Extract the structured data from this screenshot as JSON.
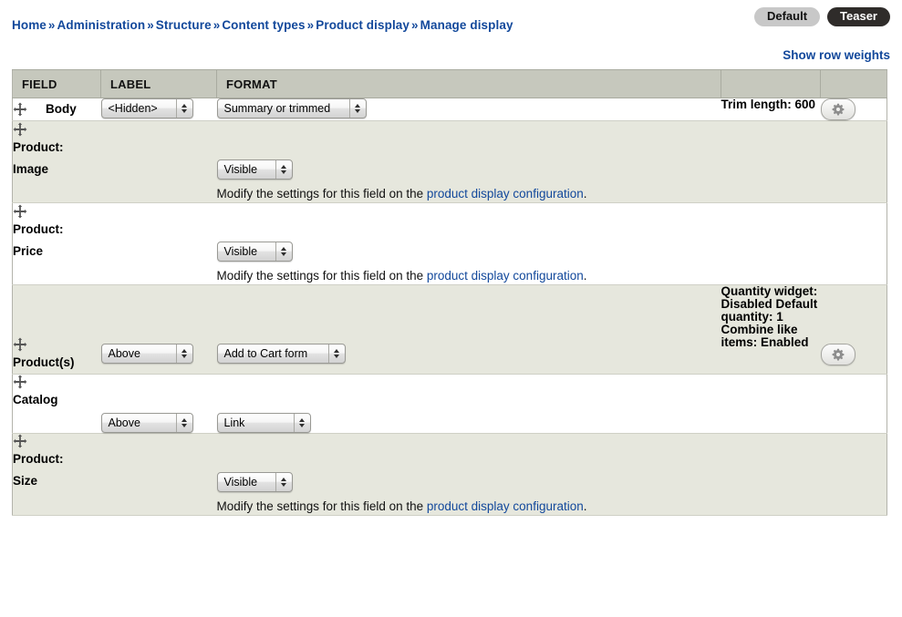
{
  "breadcrumb": {
    "separator": "»",
    "items": [
      {
        "label": "Home"
      },
      {
        "label": "Administration"
      },
      {
        "label": "Structure"
      },
      {
        "label": "Content types"
      },
      {
        "label": "Product display"
      },
      {
        "label": "Manage display"
      }
    ]
  },
  "view_tabs": [
    {
      "label": "Default",
      "state": "inactive"
    },
    {
      "label": "Teaser",
      "state": "active"
    }
  ],
  "row_weights": {
    "link_label": "Show row weights"
  },
  "table": {
    "columns": [
      "FIELD",
      "LABEL",
      "FORMAT",
      "",
      ""
    ],
    "rows": [
      {
        "field": "Body",
        "layout": "inline",
        "stripe": "odd",
        "label_select": "<Hidden>",
        "format_select": "Summary or trimmed",
        "description": null,
        "description_link": null,
        "summary": "Trim length: 600",
        "has_settings_button": true
      },
      {
        "field": "Product:\nImage",
        "layout": "stacked",
        "stripe": "even",
        "label_select": null,
        "format_select": "Visible",
        "description": "Modify the settings for this field on the ",
        "description_link": "product display configuration",
        "description_end": ".",
        "summary": null,
        "has_settings_button": false
      },
      {
        "field": "Product:\nPrice",
        "layout": "stacked",
        "stripe": "odd",
        "label_select": null,
        "format_select": "Visible",
        "description": "Modify the settings for this field on the ",
        "description_link": "product display configuration",
        "description_end": ".",
        "summary": null,
        "has_settings_button": false
      },
      {
        "field": "Product(s)",
        "layout": "inline-tall",
        "stripe": "even",
        "label_select": "Above",
        "format_select": "Add to Cart form",
        "description": null,
        "description_link": null,
        "summary": "Quantity widget: Disabled Default quantity: 1 Combine like items: Enabled",
        "has_settings_button": true
      },
      {
        "field": "Catalog",
        "layout": "stacked-inline",
        "stripe": "odd",
        "label_select": "Above",
        "format_select": "Link",
        "description": null,
        "description_link": null,
        "summary": null,
        "has_settings_button": false
      },
      {
        "field": "Product:\nSize",
        "layout": "stacked",
        "stripe": "even",
        "label_select": null,
        "format_select": "Visible",
        "description": "Modify the settings for this field on the ",
        "description_link": "product display configuration",
        "description_end": ".",
        "summary": null,
        "has_settings_button": false
      }
    ]
  },
  "icons": {
    "drag": "move-cross-icon",
    "settings": "gear-icon"
  },
  "colors": {
    "link": "#12489b",
    "header_bg": "#c6c8bd",
    "row_even_bg": "#e6e7dd",
    "row_odd_bg": "#ffffff",
    "tab_active_bg": "#2f2c2a",
    "tab_inactive_bg": "#c8c8c8"
  }
}
